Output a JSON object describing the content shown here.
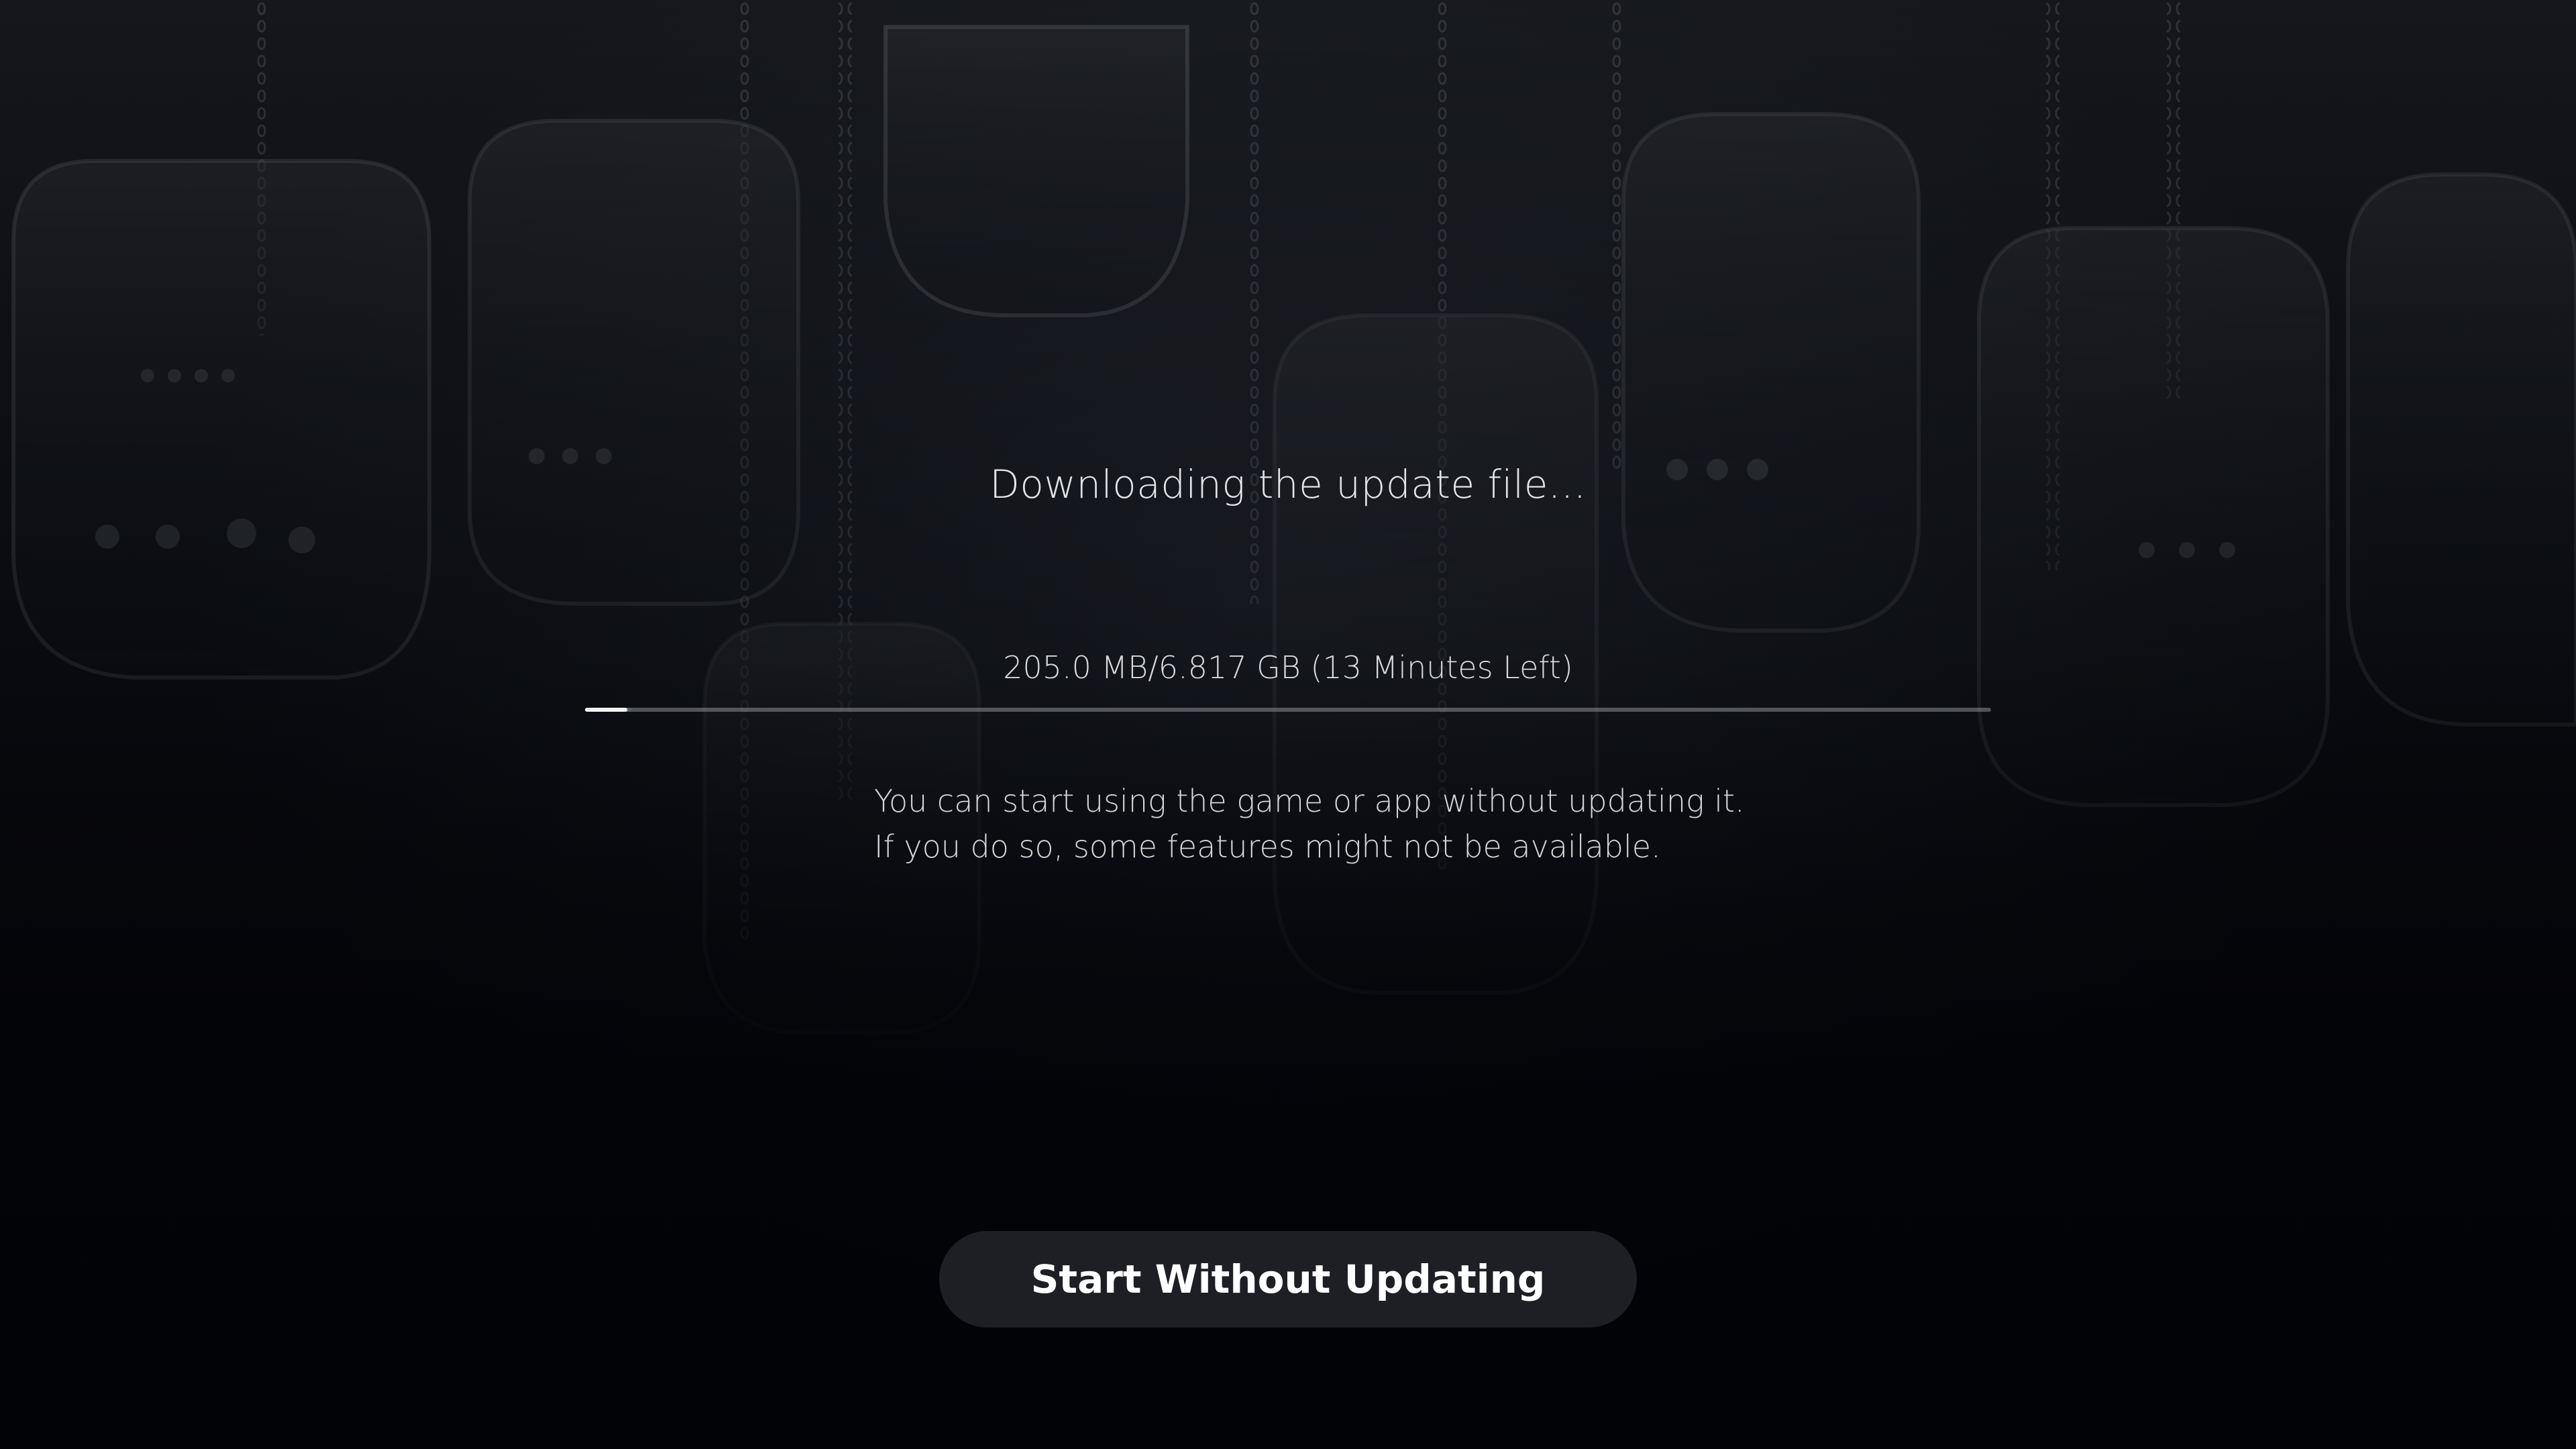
{
  "status": {
    "title": "Downloading the update file..."
  },
  "progress": {
    "text": "205.0 MB/6.817 GB (13 Minutes Left)",
    "downloaded": "205.0 MB",
    "total": "6.817 GB",
    "time_left": "13 Minutes Left",
    "fraction": 0.03
  },
  "info": {
    "line1": "You can start using the game or app without updating it.",
    "line2": "If you do so, some features might not be available."
  },
  "actions": {
    "start_without_updating": "Start Without Updating"
  },
  "colors": {
    "background": "#05070c",
    "button_bg": "#1e1f24",
    "text": "#e4e4e6",
    "progress_fill": "#f2f2f2"
  }
}
